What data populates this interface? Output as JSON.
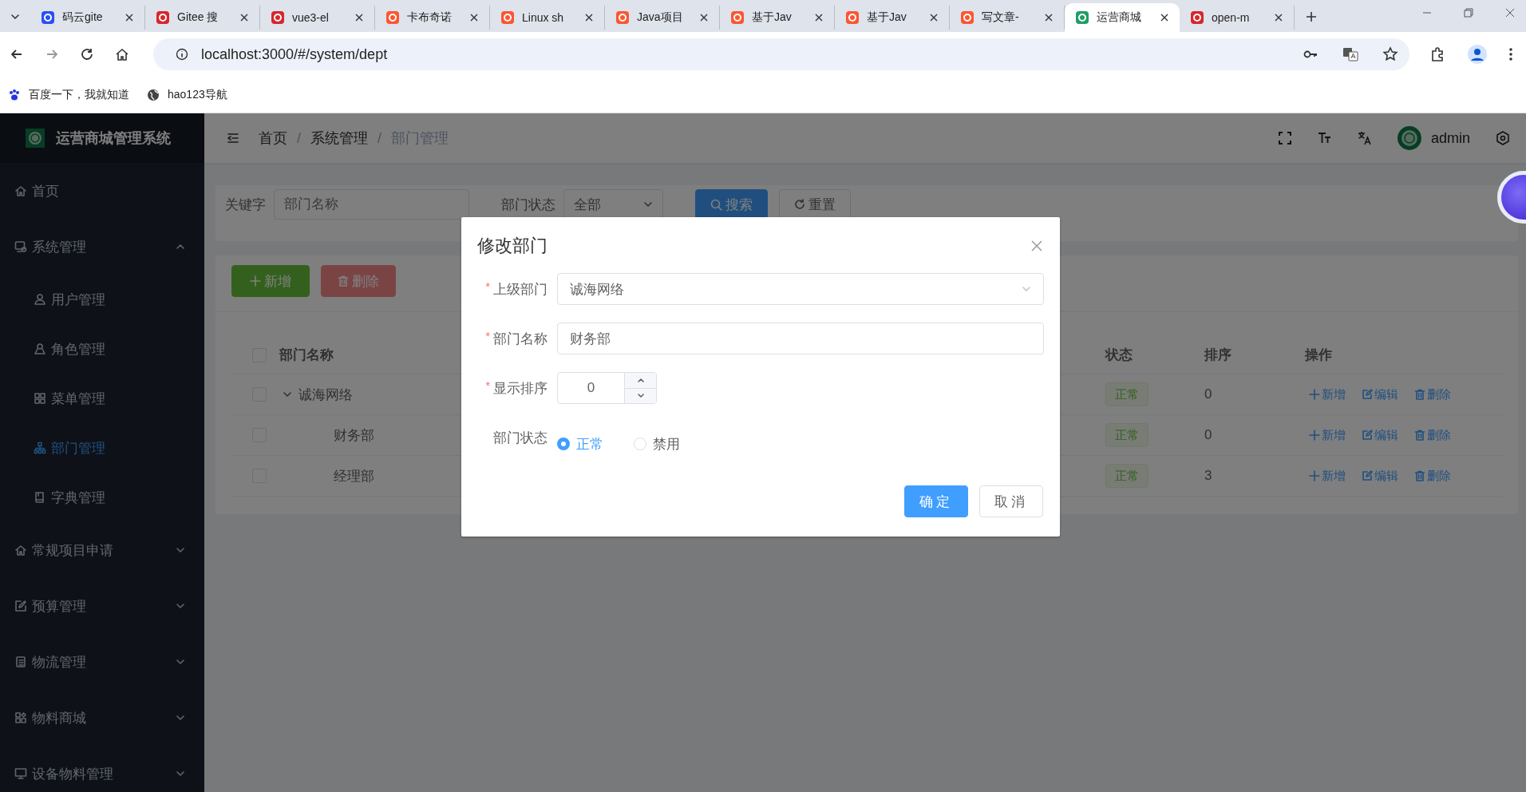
{
  "browser": {
    "tabs": [
      {
        "title": "码云gite",
        "selected": false
      },
      {
        "title": "Gitee 搜",
        "selected": false
      },
      {
        "title": "vue3-el",
        "selected": false
      },
      {
        "title": "卡布奇诺",
        "selected": false
      },
      {
        "title": "Linux sh",
        "selected": false
      },
      {
        "title": "Java项目",
        "selected": false
      },
      {
        "title": "基于Jav",
        "selected": false
      },
      {
        "title": "基于Jav",
        "selected": false
      },
      {
        "title": "写文章-",
        "selected": false
      },
      {
        "title": "运营商城",
        "selected": true
      },
      {
        "title": "open-m",
        "selected": false
      }
    ],
    "url": "localhost:3000/#/system/dept",
    "bookmarks": [
      "百度一下，我就知道",
      "hao123导航"
    ]
  },
  "app": {
    "brand": "运营商城管理系统",
    "breadcrumb": [
      "首页",
      "系统管理",
      "部门管理"
    ],
    "breadcrumb_separator": "/",
    "user": "admin"
  },
  "sidebar": {
    "items": [
      {
        "label": "首页",
        "selected": false
      },
      {
        "label": "系统管理",
        "selected": false,
        "expanded": true,
        "children": [
          {
            "label": "用户管理",
            "selected": false
          },
          {
            "label": "角色管理",
            "selected": false
          },
          {
            "label": "菜单管理",
            "selected": false
          },
          {
            "label": "部门管理",
            "selected": true
          },
          {
            "label": "字典管理",
            "selected": false
          }
        ]
      },
      {
        "label": "常规项目申请",
        "selected": false,
        "expanded": false
      },
      {
        "label": "预算管理",
        "selected": false,
        "expanded": false
      },
      {
        "label": "物流管理",
        "selected": false,
        "expanded": false
      },
      {
        "label": "物料商城",
        "selected": false,
        "expanded": false
      },
      {
        "label": "设备物料管理",
        "selected": false,
        "expanded": false
      }
    ]
  },
  "search": {
    "keyword": {
      "label": "关键字",
      "placeholder": "部门名称"
    },
    "status": {
      "label": "部门状态",
      "value": "全部"
    },
    "buttons": [
      "搜索",
      "重置"
    ]
  },
  "toolbar": [
    {
      "label": "新增",
      "disabled": false
    },
    {
      "label": "删除",
      "disabled": true
    }
  ],
  "table": {
    "all_checked": false,
    "columns": [
      "部门名称",
      "状态",
      "排序",
      "操作"
    ],
    "rows": [
      {
        "name": "诚海网络",
        "checked": false,
        "expanded": true,
        "status": "正常",
        "sort": "0",
        "actions": [
          "新增",
          "编辑",
          "删除"
        ],
        "children": [
          {
            "name": "财务部",
            "checked": false,
            "status": "正常",
            "sort": "0",
            "actions": [
              "新增",
              "编辑",
              "删除"
            ]
          },
          {
            "name": "经理部",
            "checked": false,
            "status": "正常",
            "sort": "3",
            "actions": [
              "新增",
              "编辑",
              "删除"
            ]
          }
        ]
      }
    ]
  },
  "dialog": {
    "title": "修改部门",
    "required_mark": "*",
    "fields": [
      {
        "kind": "select",
        "label": "上级部门",
        "required": true,
        "value": "诚海网络"
      },
      {
        "kind": "text",
        "label": "部门名称",
        "required": true,
        "value": "财务部"
      },
      {
        "kind": "number",
        "label": "显示排序",
        "required": true,
        "value": "0"
      },
      {
        "kind": "radio",
        "label": "部门状态",
        "required": false,
        "options": [
          {
            "label": "正常",
            "selected": true
          },
          {
            "label": "禁用",
            "selected": false
          }
        ]
      }
    ],
    "buttons": [
      {
        "label": "确定",
        "primary": true
      },
      {
        "label": "取消",
        "primary": false
      }
    ]
  }
}
